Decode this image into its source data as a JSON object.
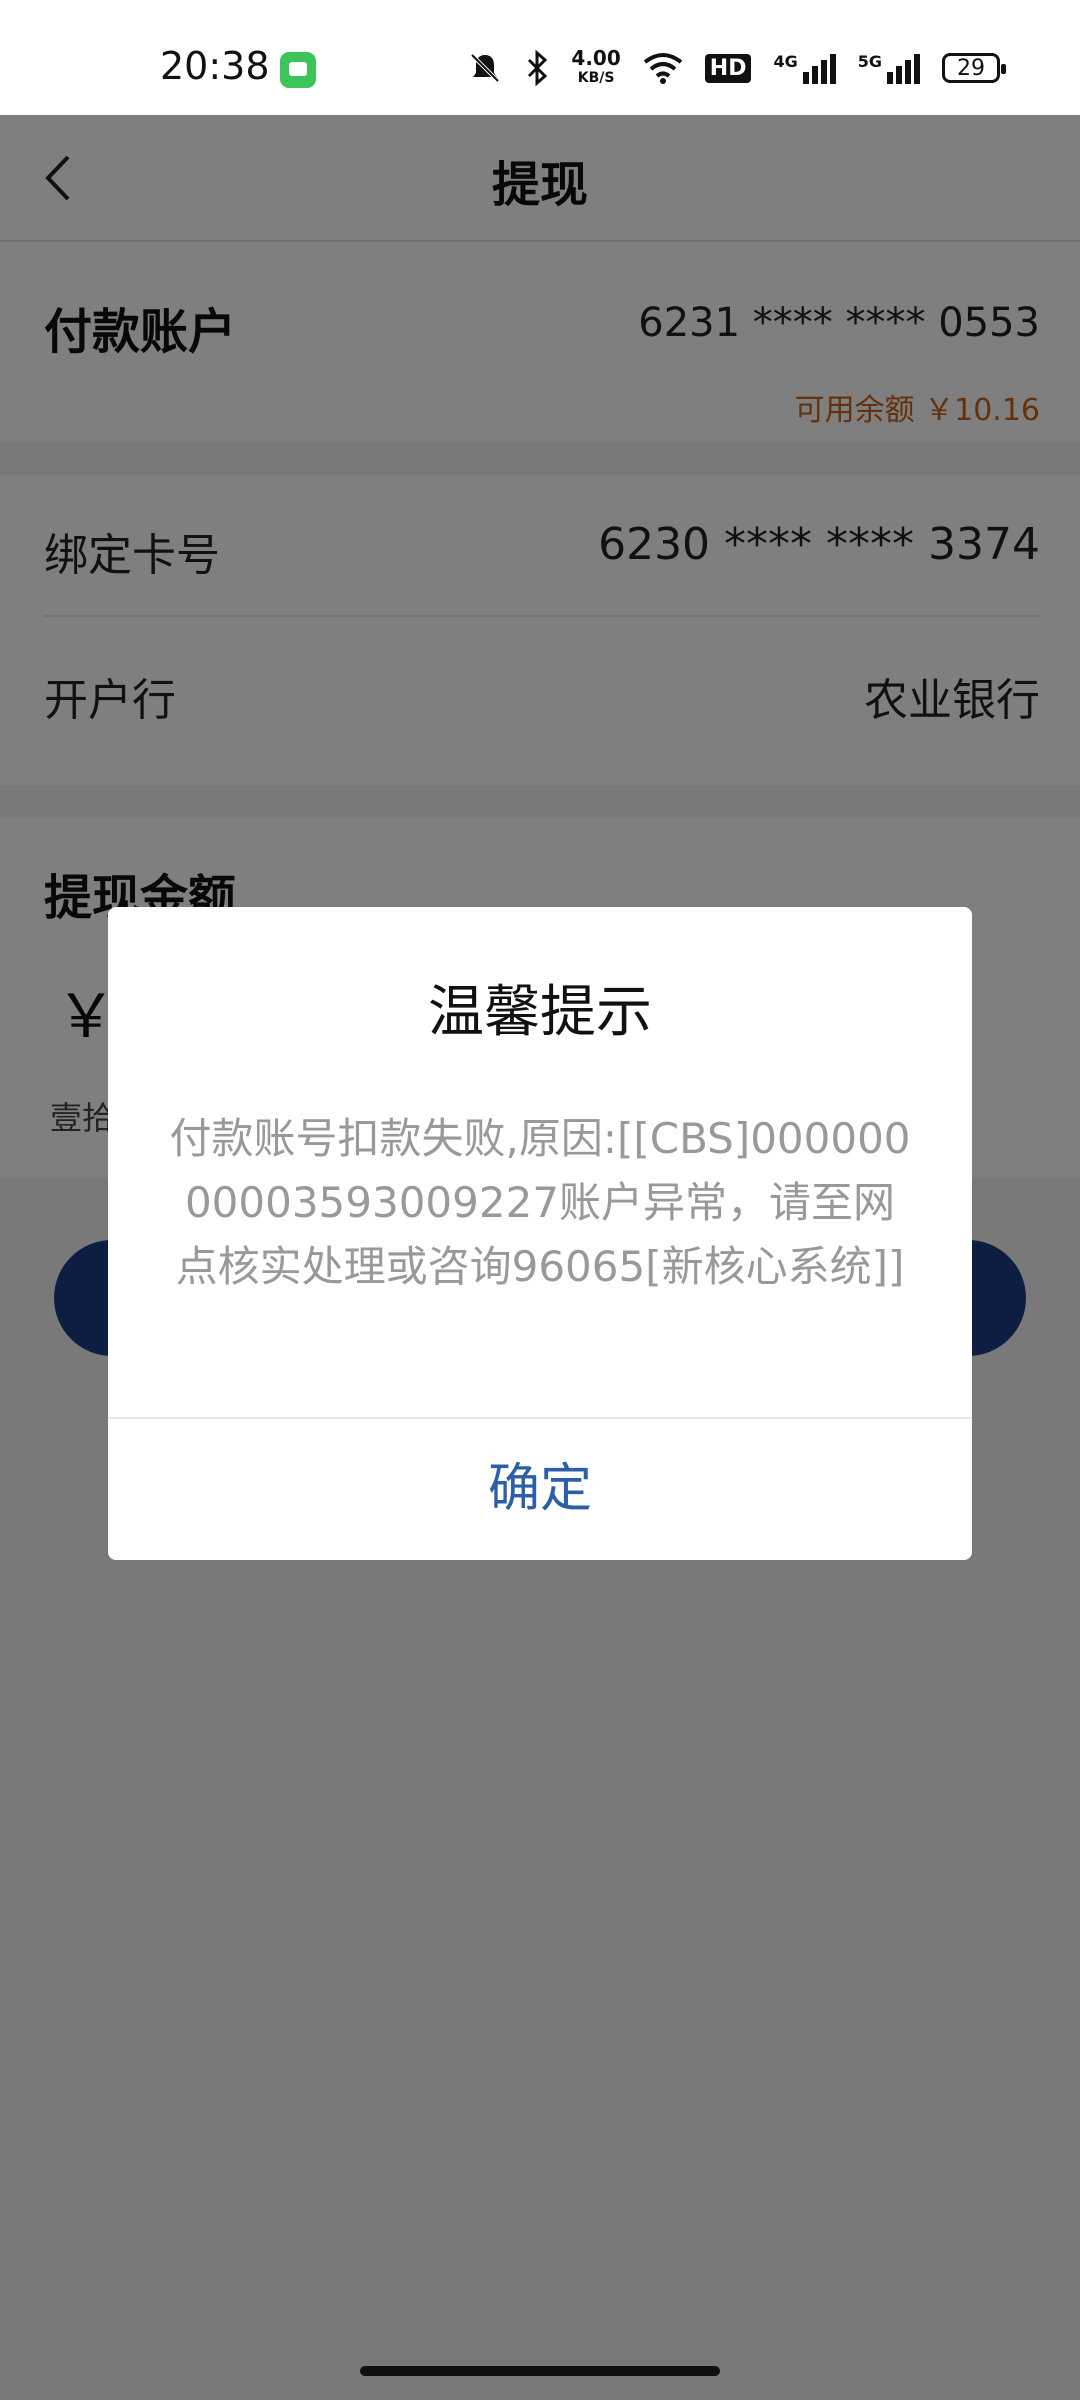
{
  "status_bar": {
    "time": "20:38",
    "net_speed_value": "4.00",
    "net_speed_unit": "KB/S",
    "hd_badge": "HD",
    "signal_1_label": "4G",
    "signal_2_label": "5G",
    "battery": "29",
    "icons": [
      "message-app-icon",
      "mute-icon",
      "bluetooth-icon",
      "wifi-icon",
      "signal-icon",
      "battery-icon"
    ]
  },
  "nav": {
    "title": "提现",
    "back_icon": "chevron-left-icon"
  },
  "pay_account": {
    "label": "付款账户",
    "account": "6231 **** **** 0553",
    "balance": "可用余额 ￥10.16"
  },
  "bind_card": {
    "card_label": "绑定卡号",
    "card_value": "6230 **** **** 3374",
    "bank_label": "开户行",
    "bank_value": "农业银行"
  },
  "amount": {
    "title": "提现金额",
    "currency": "￥",
    "words": "壹拾"
  },
  "dialog": {
    "title": "温馨提示",
    "message": "付款账号扣款失败,原因:[[CBS]00000000003593009227账户异常，请至网点核实处理或咨询96065[新核心系统]]",
    "ok_label": "确定"
  },
  "colors": {
    "accent_blue": "#2d5fa6",
    "button_navy": "#1d3c86",
    "balance_orange": "#c9621b",
    "overlay": "rgba(0,0,0,0.5)"
  }
}
